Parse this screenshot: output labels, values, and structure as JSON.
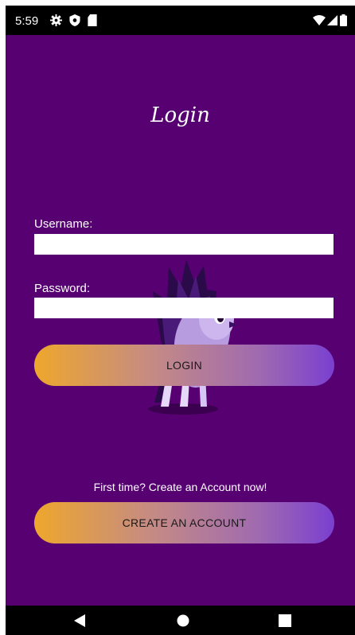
{
  "status_bar": {
    "time": "5:59",
    "icons": [
      "gear-icon",
      "shield-icon",
      "sd-card-icon",
      "wifi-icon",
      "signal-icon",
      "battery-icon"
    ]
  },
  "screen": {
    "background": "#560072",
    "title": "Login",
    "username": {
      "label": "Username:",
      "value": "",
      "placeholder": ""
    },
    "password": {
      "label": "Password:",
      "value": "",
      "placeholder": ""
    },
    "login_button": "LOGIN",
    "create_hint": "First time? Create an Account now!",
    "create_button": "CREATE AN ACCOUNT",
    "button_gradient": [
      "#eea72c",
      "#7a3fd0"
    ],
    "mascot": "hedgehog-owl-mascot"
  },
  "nav_bar": {
    "buttons": [
      "back-icon",
      "home-icon",
      "recents-icon"
    ]
  }
}
